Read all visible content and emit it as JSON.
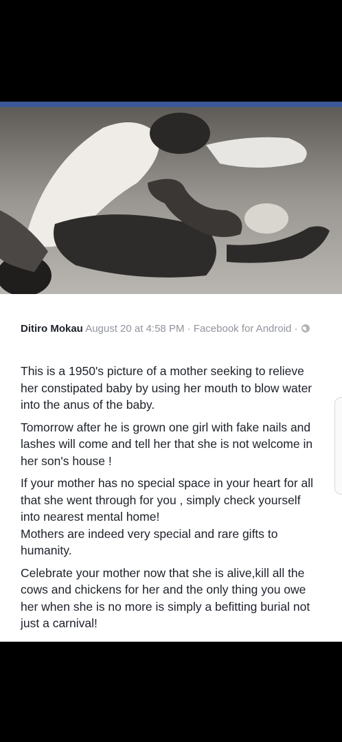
{
  "photo": {
    "description_icon": "historical-photo"
  },
  "post": {
    "author": "Ditiro Mokau",
    "timestamp": "August 20 at 4:58 PM",
    "source": "Facebook for Android",
    "privacy_icon": "globe-icon",
    "paragraphs": [
      "This is a 1950's picture of a mother seeking to relieve her constipated baby by using her mouth to blow water into the anus of the baby.",
      "Tomorrow after he is grown one girl with fake nails and lashes will come and tell her that she is not welcome in her son's house !",
      "If your mother has no special space in your heart for all that she went through for you , simply check yourself into nearest mental home!",
      "Mothers are indeed very special and rare gifts to humanity.",
      "Celebrate your mother now that she is alive,kill all the cows and chickens for her and the only thing you owe her when she is no more is simply a befitting burial not just a carnival!"
    ]
  },
  "colors": {
    "fb_blue": "#3b5998",
    "meta_gray": "#90949c",
    "text": "#1d2129"
  }
}
